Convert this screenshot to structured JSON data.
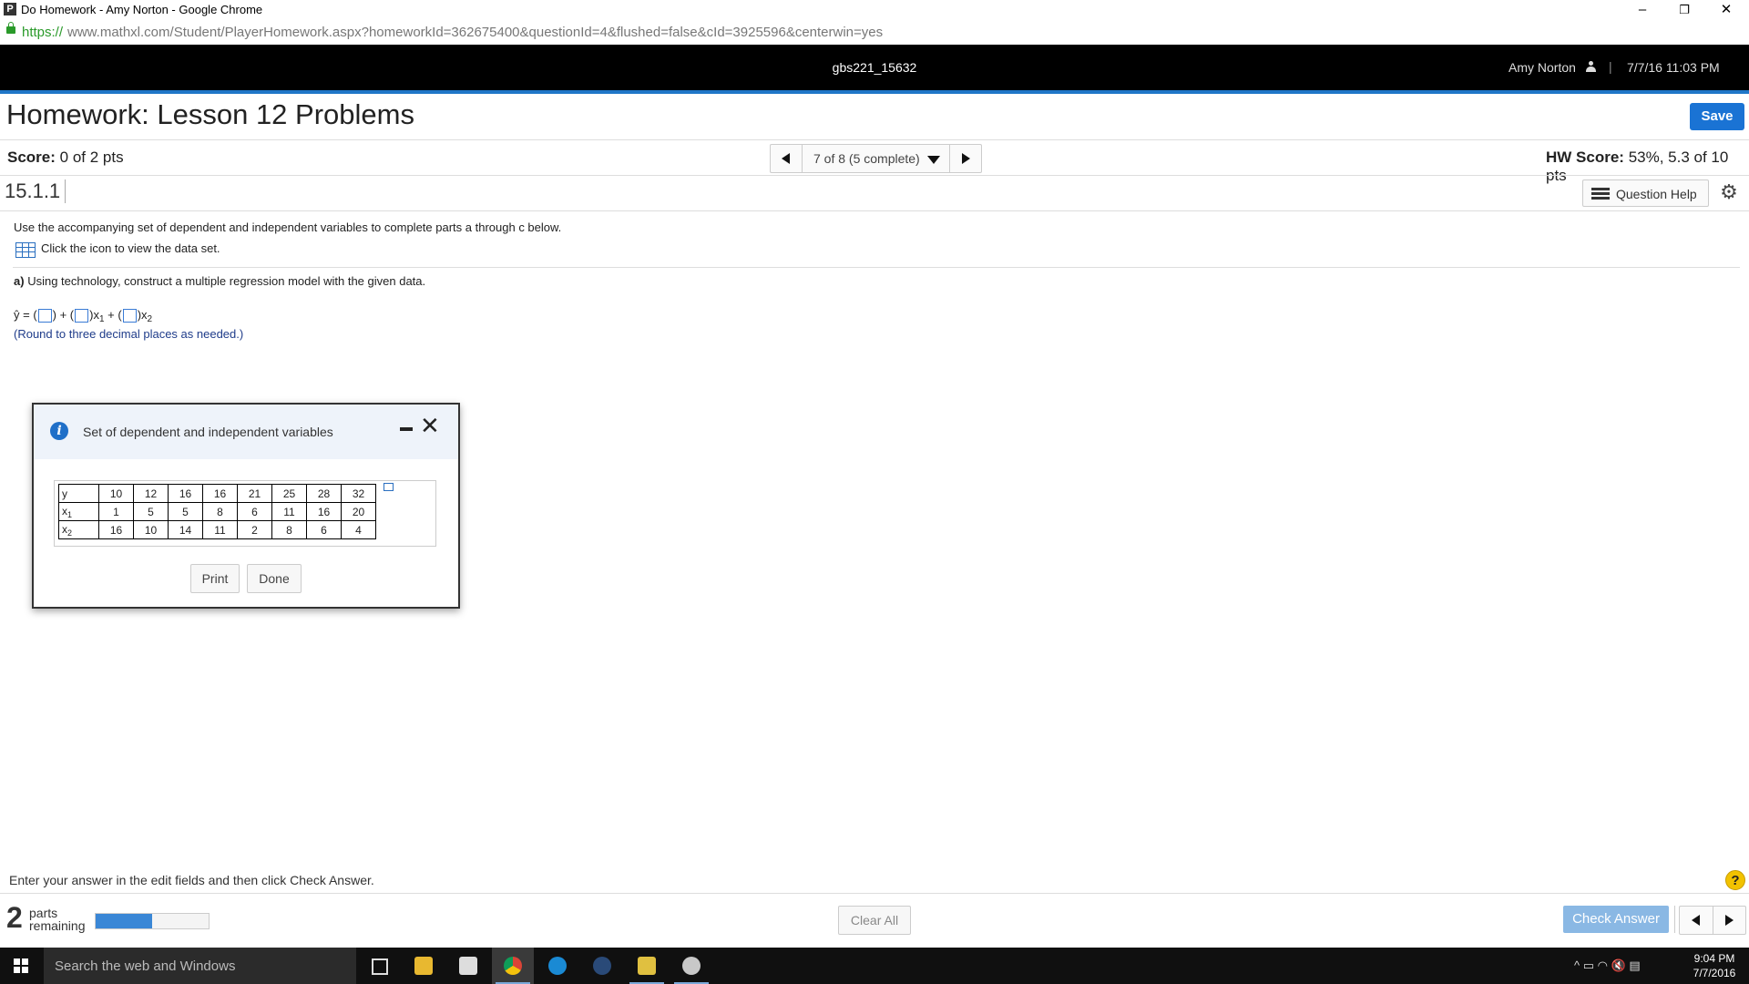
{
  "window": {
    "favicon": "P",
    "title": "Do Homework - Amy Norton - Google Chrome",
    "controls": [
      "–",
      "❐",
      "✕"
    ]
  },
  "addressbar": {
    "scheme": "https://",
    "url": "www.mathxl.com/Student/PlayerHomework.aspx?homeworkId=362675400&questionId=4&flushed=false&cId=3925596&centerwin=yes"
  },
  "header": {
    "course": "gbs221_15632",
    "user": "Amy Norton",
    "separator": "|",
    "datetime": "7/7/16 11:03 PM"
  },
  "homework": {
    "title": "Homework: Lesson 12 Problems",
    "save_label": "Save",
    "score_label": "Score:",
    "score_value": "0 of 2 pts",
    "nav_label": "7 of 8 (5 complete)",
    "hw_score_label": "HW Score:",
    "hw_score_value": "53%, 5.3 of 10 pts"
  },
  "question": {
    "number": "15.1.1",
    "help_label": "Question Help",
    "intro": "Use the accompanying set of dependent and independent variables to complete parts a through c below.",
    "dataset_link": "Click the icon to view the data set.",
    "part_a_prefix": "a)",
    "part_a_text": "Using technology, construct a multiple regression model with the given data.",
    "eq_y": "ŷ",
    "eq_equals": " = (",
    "eq_plus1": ") + (",
    "eq_x1": ")x",
    "eq_sub1": "1",
    "eq_plus2": " + (",
    "eq_x2": ")x",
    "eq_sub2": "2",
    "round_note": "(Round to three decimal places as needed.)"
  },
  "dialog": {
    "info_glyph": "i",
    "title": "Set of dependent and independent variables",
    "close_glyph": "✕",
    "table": {
      "rows": [
        {
          "label": "y",
          "sub": "",
          "values": [
            "10",
            "12",
            "16",
            "16",
            "21",
            "25",
            "28",
            "32"
          ]
        },
        {
          "label": "x",
          "sub": "1",
          "values": [
            "1",
            "5",
            "5",
            "8",
            "6",
            "11",
            "16",
            "20"
          ]
        },
        {
          "label": "x",
          "sub": "2",
          "values": [
            "16",
            "10",
            "14",
            "11",
            "2",
            "8",
            "6",
            "4"
          ]
        }
      ]
    },
    "print_label": "Print",
    "done_label": "Done"
  },
  "footer": {
    "instruction": "Enter your answer in the edit fields and then click Check Answer.",
    "help_glyph": "?",
    "parts_count": "2",
    "parts_label_1": "parts",
    "parts_label_2": "remaining",
    "progress_fraction": 0.5,
    "clear_all_label": "Clear All",
    "check_answer_label": "Check Answer"
  },
  "taskbar": {
    "search_placeholder": "Search the web and Windows",
    "tray_icons": "^  ▭  ◠  🔇  ▤",
    "time": "9:04 PM",
    "date": "7/7/2016"
  }
}
